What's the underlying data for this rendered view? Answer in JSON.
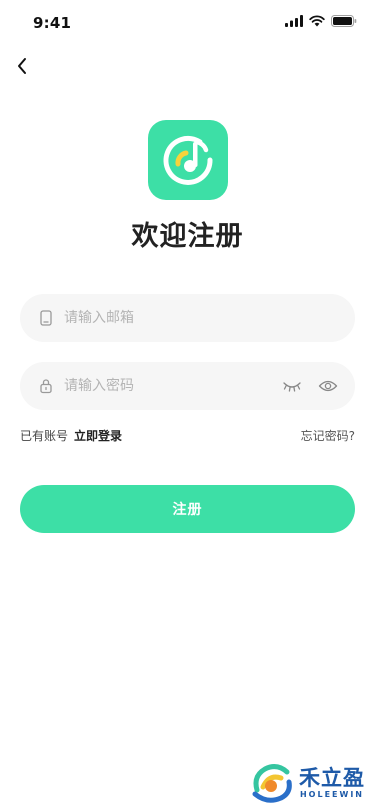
{
  "status_bar": {
    "time": "9:41"
  },
  "header": {
    "back_icon": "chevron-left-icon"
  },
  "logo": {
    "icon": "music-note-logo-icon",
    "bg_color": "#3ddfa6"
  },
  "title": "欢迎注册",
  "email_field": {
    "placeholder": "请输入邮箱",
    "value": "",
    "icon": "phone-icon"
  },
  "password_field": {
    "placeholder": "请输入密码",
    "value": "",
    "icon": "lock-icon",
    "trail_icons": [
      "eye-closed-icon",
      "eye-icon"
    ]
  },
  "links": {
    "has_account": "已有账号",
    "login": "立即登录",
    "forgot": "忘记密码?"
  },
  "register_button": {
    "label": "注册",
    "color": "#3ddfa6"
  },
  "watermark": {
    "cn": "禾立盈",
    "en": "HOLEEWIN"
  }
}
